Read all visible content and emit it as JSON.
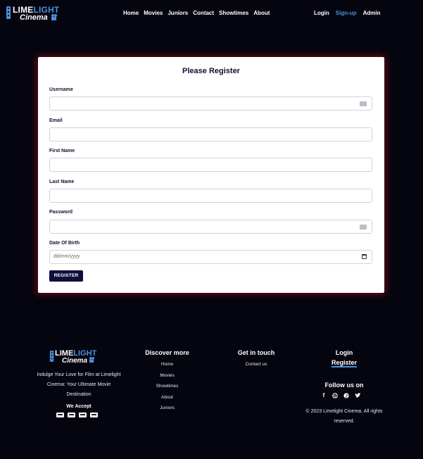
{
  "brand": {
    "name_part1": "L",
    "name_part2": "IME",
    "name_part3": "LIGHT",
    "name_line2": "Cinema"
  },
  "nav": {
    "links": [
      "Home",
      "Movies",
      "Juniors",
      "Contact",
      "Showtimes",
      "About"
    ],
    "right": [
      {
        "label": "Login",
        "active": false
      },
      {
        "label": "Sign-up",
        "active": true
      },
      {
        "label": "Admin",
        "active": false
      }
    ]
  },
  "form": {
    "title": "Please Register",
    "fields": [
      {
        "label": "Username",
        "value": "",
        "placeholder": ""
      },
      {
        "label": "Email",
        "value": "",
        "placeholder": ""
      },
      {
        "label": "First Name",
        "value": "",
        "placeholder": ""
      },
      {
        "label": "Last Name",
        "value": "",
        "placeholder": ""
      },
      {
        "label": "Password",
        "value": "",
        "placeholder": ""
      },
      {
        "label": "Date Of Birth",
        "value": "",
        "placeholder": "dd/mm/yyyy"
      }
    ],
    "submit_label": "REGISTER"
  },
  "footer": {
    "tagline": "Indulge Your Love for Film at Limelight Cinema: Your Ultimate Movie Destination",
    "we_accept": "We Accept",
    "payment_icons": [
      "visa-icon",
      "card-icon",
      "mastercard-icon",
      "amex-icon"
    ],
    "discover_title": "Discover more",
    "discover_links": [
      "Home",
      "Movies",
      "Showtimes",
      "About",
      "Juniors"
    ],
    "touch_title": "Get in touch",
    "contact_link": "Contact us",
    "login": "Login",
    "register": "Register",
    "follow_title": "Follow us on",
    "socials": [
      "facebook-icon",
      "dribbble-icon",
      "pinterest-icon",
      "twitter-icon"
    ],
    "copyright": "© 2023 Limelight Cinema. All rights reserved."
  },
  "colors": {
    "accent": "#4a8fd9",
    "background": "#050510",
    "button": "#0f0f3a",
    "glow": "#b41414"
  }
}
